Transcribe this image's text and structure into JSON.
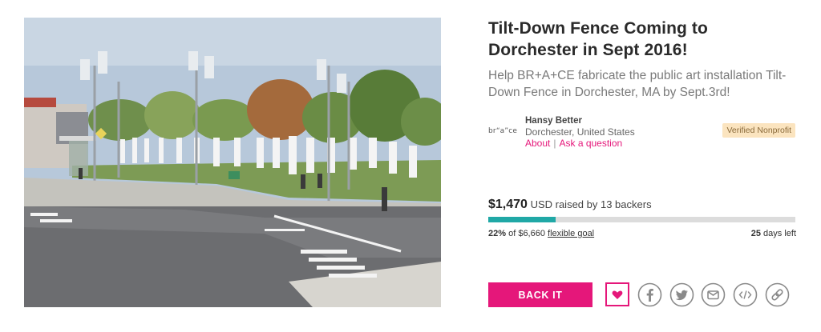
{
  "campaign": {
    "title": "Tilt-Down Fence Coming to Dorchester in Sept 2016!",
    "tagline": "Help BR+A+CE fabricate the public art installation Tilt-Down Fence in Dorchester, MA by Sept.3rd!"
  },
  "owner": {
    "logo_text": "br“a”ce",
    "name": "Hansy Better",
    "location": "Dorchester, United States",
    "about_label": "About",
    "separator": "|",
    "ask_label": "Ask a question",
    "badge": "Verified Nonprofit"
  },
  "funding": {
    "amount": "$1,470",
    "raised_text": "USD raised by 13 backers",
    "progress_fraction": 0.22,
    "percent": "22%",
    "of_goal": "of $6,660",
    "goal_type": "flexible goal",
    "days_left": "25",
    "days_left_label": "days left"
  },
  "actions": {
    "back_label": "BACK IT",
    "share_icons": [
      "heart-icon",
      "facebook-icon",
      "twitter-icon",
      "email-icon",
      "embed-icon",
      "link-icon"
    ]
  },
  "colors": {
    "accent": "#e5177a",
    "progress": "#20a8a6",
    "badge_bg": "#fbe4bf",
    "icon_gray": "#8a8a8a"
  }
}
